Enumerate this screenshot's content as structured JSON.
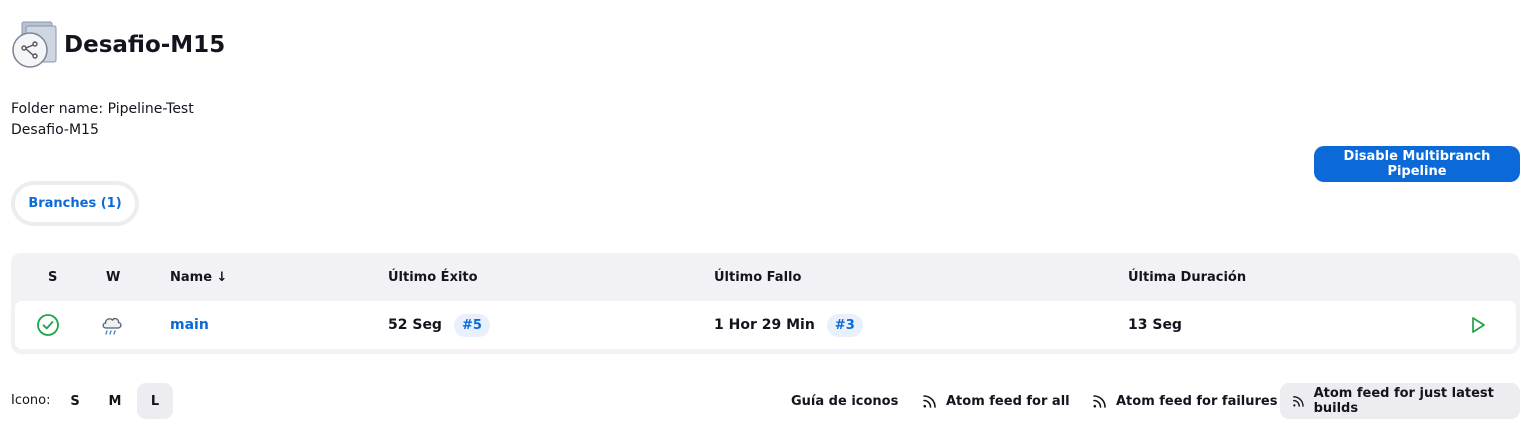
{
  "header": {
    "title": "Desafio-M15",
    "icon": "multibranch-folder-icon"
  },
  "description": {
    "folder_name": "Folder name: Pipeline-Test",
    "name": "Desafio-M15"
  },
  "actions": {
    "disable_label": "Disable Multibranch Pipeline"
  },
  "tabs": [
    {
      "label": "Branches (1)",
      "active": true
    }
  ],
  "table": {
    "columns": {
      "s": "S",
      "w": "W",
      "name": "Name ↓",
      "last_success": "Último Éxito",
      "last_failure": "Último Fallo",
      "last_duration": "Última Duración"
    },
    "rows": [
      {
        "status_icon": "success-check-icon",
        "weather_icon": "rain-cloud-icon",
        "name": "main",
        "last_success_time": "52 Seg",
        "last_success_build": "#5",
        "last_failure_time": "1 Hor 29 Min",
        "last_failure_build": "#3",
        "last_duration": "13 Seg",
        "action_icon": "play-icon"
      }
    ]
  },
  "footer": {
    "icon_label": "Icono:",
    "sizes": [
      "S",
      "M",
      "L"
    ],
    "selected_size": "L",
    "legend_link": "Guía de iconos",
    "feed_all": "Atom feed for all",
    "feed_failures": "Atom feed for failures",
    "feed_latest": "Atom feed for just latest builds"
  },
  "colors": {
    "accent": "#0b6ad8",
    "success": "#1ea446",
    "surface": "#f2f2f6"
  }
}
